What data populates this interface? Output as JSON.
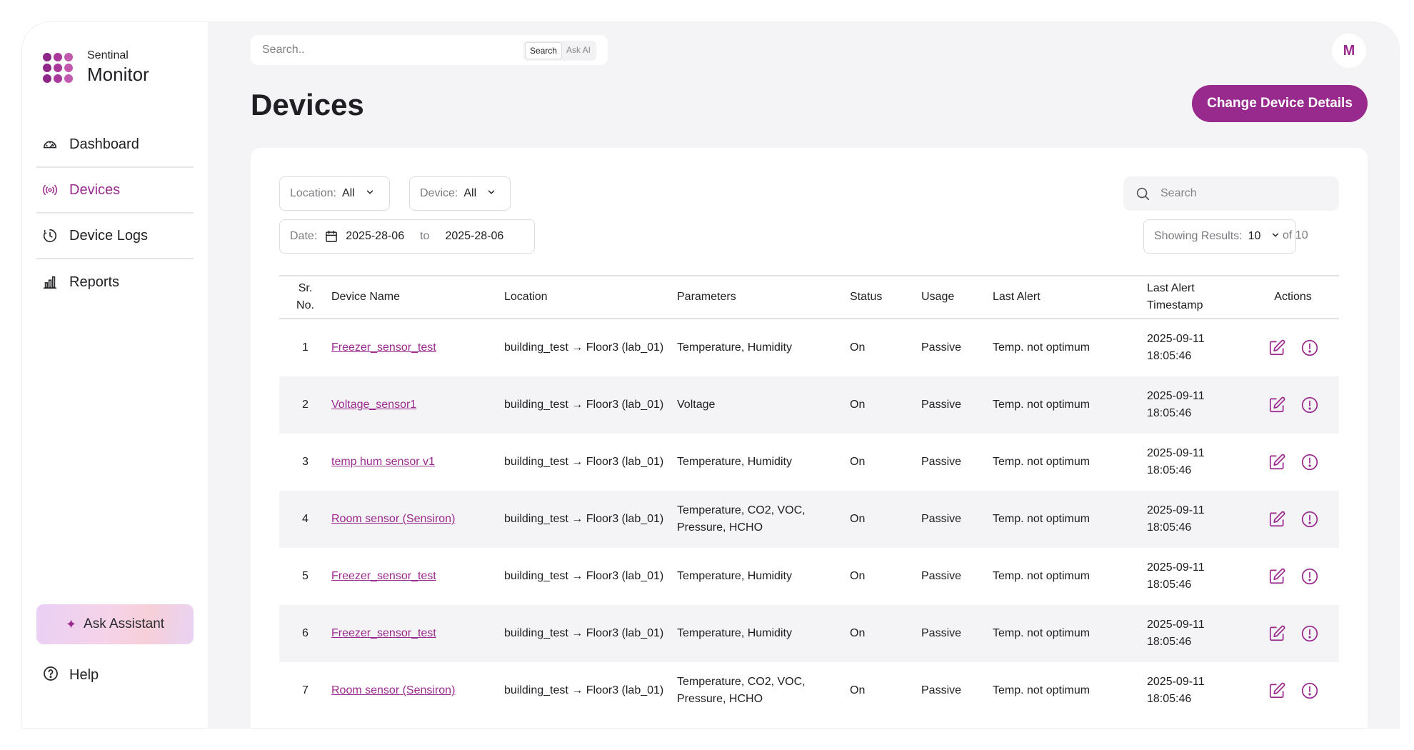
{
  "brand": {
    "line1": "Sentinal",
    "line2": "Monitor",
    "logo_colors": [
      "#8e2787",
      "#a8399a",
      "#c15aae",
      "#8e2787",
      "#a8399a",
      "#c15aae",
      "#8e2787",
      "#a8399a",
      "#c15aae"
    ]
  },
  "sidebar": {
    "items": [
      {
        "label": "Dashboard",
        "icon": "gauge-icon",
        "active": false
      },
      {
        "label": "Devices",
        "icon": "broadcast-icon",
        "active": true
      },
      {
        "label": "Device Logs",
        "icon": "history-icon",
        "active": false
      },
      {
        "label": "Reports",
        "icon": "bar-chart-icon",
        "active": false
      }
    ],
    "assistant_label": "Ask Assistant",
    "help_label": "Help"
  },
  "topbar": {
    "search_placeholder": "Search..",
    "mode_search": "Search",
    "mode_ai": "Ask AI",
    "avatar_initial": "M"
  },
  "header": {
    "title": "Devices",
    "primary_button": "Change Device Details"
  },
  "filters": {
    "location_key": "Location:",
    "location_value": "All",
    "device_key": "Device:",
    "device_value": "All",
    "date_key": "Date:",
    "date_from": "2025-28-06",
    "date_sep": "to",
    "date_to": "2025-28-06",
    "search_placeholder": "Search",
    "showing_key": "Showing Results:",
    "showing_value": "10",
    "of_total": "of 10"
  },
  "table": {
    "headers": {
      "no": "Sr. No.",
      "name": "Device Name",
      "location": "Location",
      "parameters": "Parameters",
      "status": "Status",
      "usage": "Usage",
      "last_alert": "Last Alert",
      "timestamp": "Last Alert Timestamp",
      "actions": "Actions"
    },
    "rows": [
      {
        "no": "1",
        "name": "Freezer_sensor_test",
        "location": "building_test → Floor3 (lab_01)",
        "parameters": "Temperature, Humidity",
        "status": "On",
        "usage": "Passive",
        "alert": "Temp. not optimum",
        "timestamp": "2025-09-11 18:05:46"
      },
      {
        "no": "2",
        "name": "Voltage_sensor1",
        "location": "building_test → Floor3 (lab_01)",
        "parameters": "Voltage",
        "status": "On",
        "usage": "Passive",
        "alert": "Temp. not optimum",
        "timestamp": "2025-09-11 18:05:46"
      },
      {
        "no": "3",
        "name": "temp hum sensor v1",
        "location": "building_test → Floor3 (lab_01)",
        "parameters": "Temperature, Humidity",
        "status": "On",
        "usage": "Passive",
        "alert": "Temp. not optimum",
        "timestamp": "2025-09-11 18:05:46"
      },
      {
        "no": "4",
        "name": "Room sensor (Sensiron)",
        "location": "building_test → Floor3 (lab_01)",
        "parameters": "Temperature, CO2, VOC, Pressure, HCHO",
        "status": "On",
        "usage": "Passive",
        "alert": "Temp. not optimum",
        "timestamp": "2025-09-11 18:05:46"
      },
      {
        "no": "5",
        "name": "Freezer_sensor_test",
        "location": "building_test → Floor3 (lab_01)",
        "parameters": "Temperature, Humidity",
        "status": "On",
        "usage": "Passive",
        "alert": "Temp. not optimum",
        "timestamp": "2025-09-11 18:05:46"
      },
      {
        "no": "6",
        "name": "Freezer_sensor_test",
        "location": "building_test → Floor3 (lab_01)",
        "parameters": "Temperature, Humidity",
        "status": "On",
        "usage": "Passive",
        "alert": "Temp. not optimum",
        "timestamp": "2025-09-11 18:05:46"
      },
      {
        "no": "7",
        "name": "Room sensor (Sensiron)",
        "location": "building_test → Floor3 (lab_01)",
        "parameters": "Temperature, CO2, VOC, Pressure, HCHO",
        "status": "On",
        "usage": "Passive",
        "alert": "Temp. not optimum",
        "timestamp": "2025-09-11 18:05:46"
      }
    ],
    "action_icons": [
      "edit-icon",
      "alert-circle-icon"
    ]
  },
  "colors": {
    "accent": "#9b2a8e",
    "button": "#972a8c",
    "bg": "#f4f3f6"
  }
}
